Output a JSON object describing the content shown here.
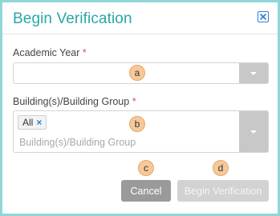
{
  "dialog": {
    "title": "Begin Verification",
    "close_icon": "close-x-icon"
  },
  "fields": {
    "academic_year": {
      "label": "Academic Year",
      "required_mark": "*",
      "value": "",
      "marker": "a"
    },
    "building": {
      "label": "Building(s)/Building Group",
      "required_mark": "*",
      "selected_tags": [
        "All"
      ],
      "tag_remove_glyph": "×",
      "placeholder": "Building(s)/Building Group",
      "marker": "b"
    }
  },
  "buttons": {
    "cancel": {
      "label": "Cancel",
      "marker": "c"
    },
    "begin": {
      "label": "Begin Verification",
      "marker": "d",
      "disabled": true
    }
  },
  "colors": {
    "title": "#2aa6a6",
    "frame": "#8fd6d8",
    "required": "#d9534f",
    "marker_fill": "#f6c89a",
    "cancel_bg": "#9a9a9a",
    "begin_bg_disabled": "#d2d2d2",
    "close_icon": "#2a7fd4"
  }
}
